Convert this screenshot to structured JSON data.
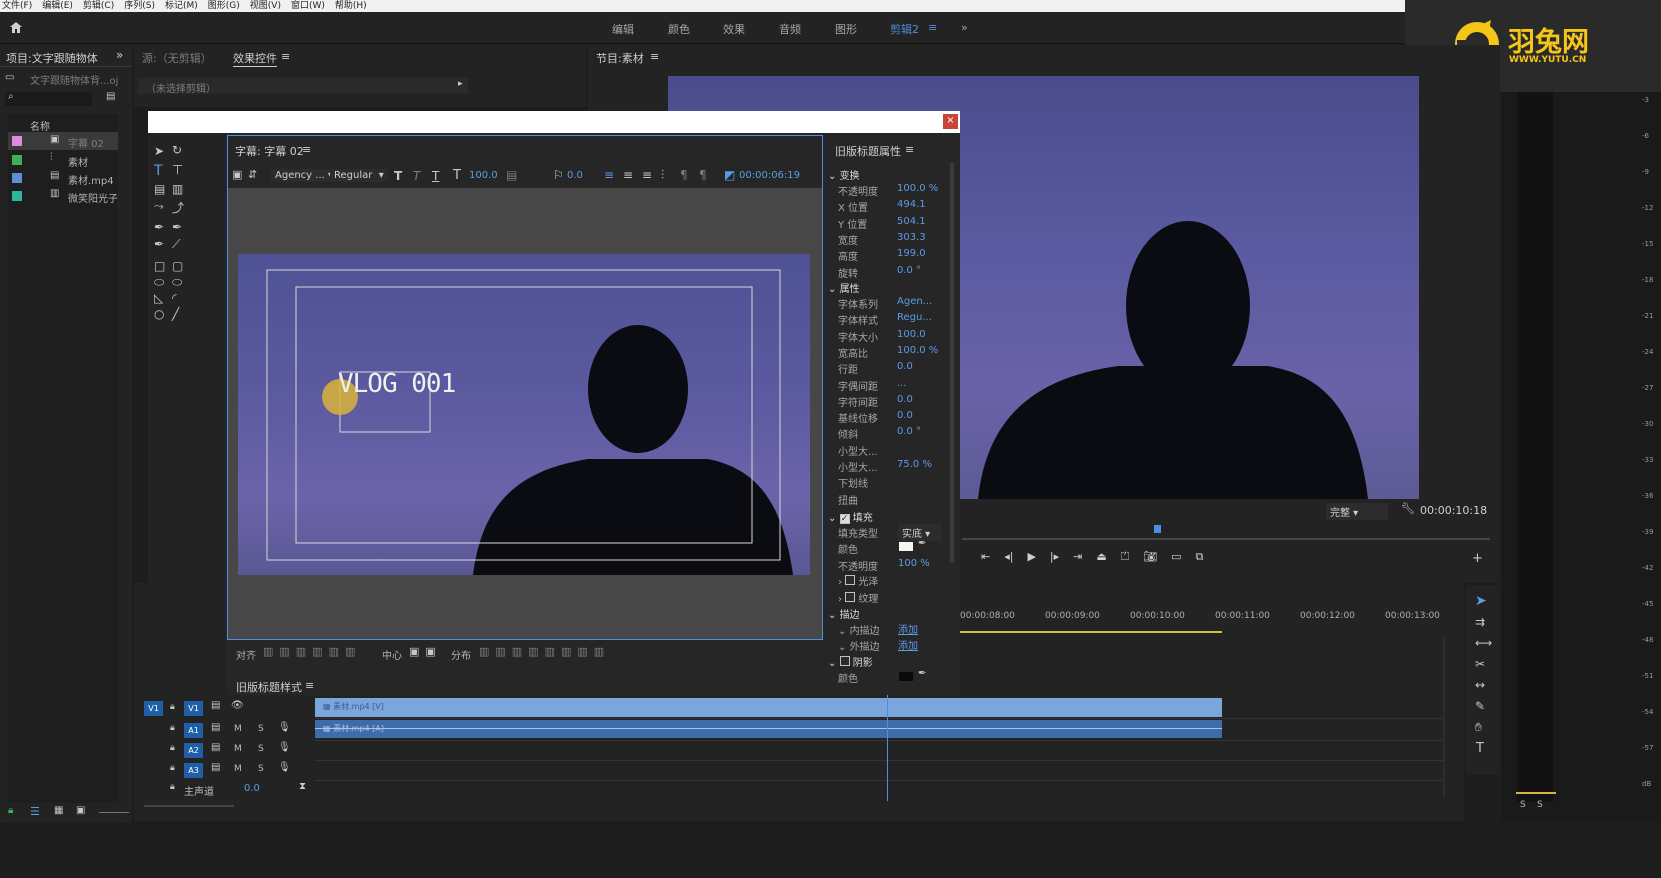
{
  "menu": [
    "文件(F)",
    "编辑(E)",
    "剪辑(C)",
    "序列(S)",
    "标记(M)",
    "图形(G)",
    "视图(V)",
    "窗口(W)",
    "帮助(H)"
  ],
  "workspaces": [
    "编辑",
    "颜色",
    "效果",
    "音频",
    "图形",
    "剪辑2"
  ],
  "workspace_more": "»",
  "logo": {
    "text": "羽兔网",
    "url": "WWW.YUTU.CN"
  },
  "project": {
    "title": "项目:文字跟随物体",
    "file": "文字跟随物体背...oj",
    "column": "名称",
    "items": [
      {
        "label": "字幕 02",
        "color": "#e08adf"
      },
      {
        "label": "素材",
        "color": "#3fb05a"
      },
      {
        "label": "素材.mp4",
        "color": "#5b8fd8"
      },
      {
        "label": "微笑阳光子",
        "color": "#2eb89a"
      }
    ]
  },
  "source": {
    "tab1": "源:（无剪辑）",
    "tab2": "效果控件",
    "no_clip": "（未选择剪辑）"
  },
  "program": {
    "title": "节目:素材",
    "quality": "完整",
    "timecode": "00:00:10:18"
  },
  "title_editor": {
    "title": "字幕: 字幕 02",
    "font": "Agency ...",
    "style": "Regular",
    "size": "100.0",
    "kerning": "0.0",
    "timecode": "00:00:06:19",
    "text": "VLOG 001",
    "align_label": "对齐",
    "center_label": "中心",
    "distribute_label": "分布",
    "styles_label": "旧版标题样式"
  },
  "props": {
    "title": "旧版标题属性",
    "transform": "变换",
    "rows_transform": [
      {
        "label": "不透明度",
        "value": "100.0 %"
      },
      {
        "label": "X 位置",
        "value": "494.1"
      },
      {
        "label": "Y 位置",
        "value": "504.1"
      },
      {
        "label": "宽度",
        "value": "303.3"
      },
      {
        "label": "高度",
        "value": "199.0"
      },
      {
        "label": "旋转",
        "value": "0.0 °"
      }
    ],
    "attributes": "属性",
    "rows_attr": [
      {
        "label": "字体系列",
        "value": "Agen..."
      },
      {
        "label": "字体样式",
        "value": "Regu..."
      },
      {
        "label": "字体大小",
        "value": "100.0"
      },
      {
        "label": "宽高比",
        "value": "100.0 %"
      },
      {
        "label": "行距",
        "value": "0.0"
      },
      {
        "label": "字偶间距",
        "value": "..."
      },
      {
        "label": "字符间距",
        "value": "0.0"
      },
      {
        "label": "基线位移",
        "value": "0.0"
      },
      {
        "label": "倾斜",
        "value": "0.0 °"
      },
      {
        "label": "小型大...",
        "value": ""
      },
      {
        "label": "小型大...",
        "value": "75.0 %"
      },
      {
        "label": "下划线",
        "value": ""
      },
      {
        "label": "扭曲",
        "value": ""
      }
    ],
    "fill": "填充",
    "fill_type_label": "填充类型",
    "fill_type": "实底",
    "color_label": "颜色",
    "opacity_label": "不透明度",
    "opacity": "100 %",
    "sheen": "光泽",
    "texture": "纹理",
    "stroke": "描边",
    "inner_stroke": "内描边",
    "outer_stroke": "外描边",
    "add": "添加",
    "shadow": "阴影",
    "shadow_color": "颜色"
  },
  "timeline": {
    "times": [
      "00:00:08:00",
      "00:00:09:00",
      "00:00:10:00",
      "00:00:11:00",
      "00:00:12:00",
      "00:00:13:00"
    ],
    "tracks": [
      "V1",
      "A1",
      "A2",
      "A3"
    ],
    "source_v": "V1",
    "clip_v": "素材.mp4 [V]",
    "clip_a": "素材.mp4 [A]",
    "master": "主声道",
    "master_val": "0.0",
    "m": "M",
    "s": "S"
  },
  "meter": {
    "ticks": [
      "-3",
      "-6",
      "-9",
      "-12",
      "-15",
      "-18",
      "-21",
      "-24",
      "-27",
      "-30",
      "-33",
      "-36",
      "-39",
      "-42",
      "-45",
      "-48",
      "-51",
      "-54",
      "-57",
      "dB"
    ],
    "solo": [
      "S",
      "S"
    ]
  }
}
